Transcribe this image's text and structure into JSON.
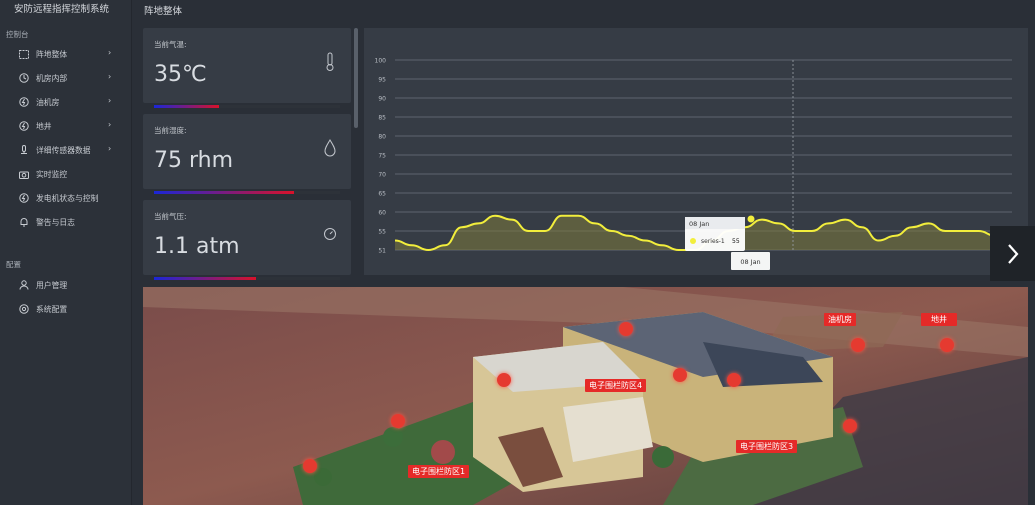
{
  "app": {
    "title": "安防远程指挥控制系统"
  },
  "sidebar": {
    "section_console": "控制台",
    "section_config": "配置",
    "items": [
      {
        "label": "阵地整体",
        "icon": "layout-icon",
        "has_arrow": true
      },
      {
        "label": "机房内部",
        "icon": "room-icon",
        "has_arrow": true
      },
      {
        "label": "油机房",
        "icon": "generator-room-icon",
        "has_arrow": true
      },
      {
        "label": "地井",
        "icon": "well-icon",
        "has_arrow": true
      },
      {
        "label": "详细传感器数据",
        "icon": "sensor-icon",
        "has_arrow": true
      },
      {
        "label": "实时监控",
        "icon": "camera-icon",
        "has_arrow": false
      },
      {
        "label": "发电机状态与控制",
        "icon": "power-icon",
        "has_arrow": false
      },
      {
        "label": "警告与日志",
        "icon": "bell-icon",
        "has_arrow": false
      }
    ],
    "config_items": [
      {
        "label": "用户管理",
        "icon": "user-icon"
      },
      {
        "label": "系统配置",
        "icon": "settings-icon"
      }
    ]
  },
  "header": {
    "page_title": "阵地整体"
  },
  "cards": [
    {
      "label": "当前气温:",
      "value": "35℃",
      "icon": "thermometer-icon",
      "level": 0.35
    },
    {
      "label": "当前湿度:",
      "value": "75 rhm",
      "icon": "droplet-icon",
      "level": 0.75
    },
    {
      "label": "当前气压:",
      "value": "1.1 atm",
      "icon": "gauge-icon",
      "level": 0.55
    }
  ],
  "tooltip": {
    "title": "08 Jan",
    "series": "series-1",
    "value": "55",
    "xlabel": "08 Jan"
  },
  "colors": {
    "line": "#f2ee3c",
    "accent_start": "#1a26d8",
    "accent_end": "#d8122a",
    "tag": "#e52a28"
  },
  "scene_labels": {
    "generator_room": "油机房",
    "well": "地井",
    "fence_zone_4": "电子围栏防区4",
    "fence_zone_3": "电子围栏防区3",
    "fence_zone_1": "电子围栏防区1"
  },
  "chart_data": {
    "type": "area",
    "title": "",
    "xlabel": "",
    "ylabel": "",
    "y_ticks": [
      "51",
      "55",
      "60",
      "65",
      "70",
      "75",
      "80",
      "85",
      "90",
      "95",
      "100"
    ],
    "ylim": [
      51,
      100
    ],
    "grid": true,
    "legend": "none",
    "series": [
      {
        "values": [
          53,
          52,
          51,
          52,
          56,
          57,
          59,
          58,
          55,
          55,
          59,
          59,
          57,
          55,
          54,
          53,
          52,
          51,
          51,
          53,
          55,
          56,
          58,
          57,
          55,
          55,
          57,
          58,
          56,
          53,
          54,
          56,
          57,
          55,
          55,
          55,
          54,
          54
        ]
      }
    ]
  }
}
